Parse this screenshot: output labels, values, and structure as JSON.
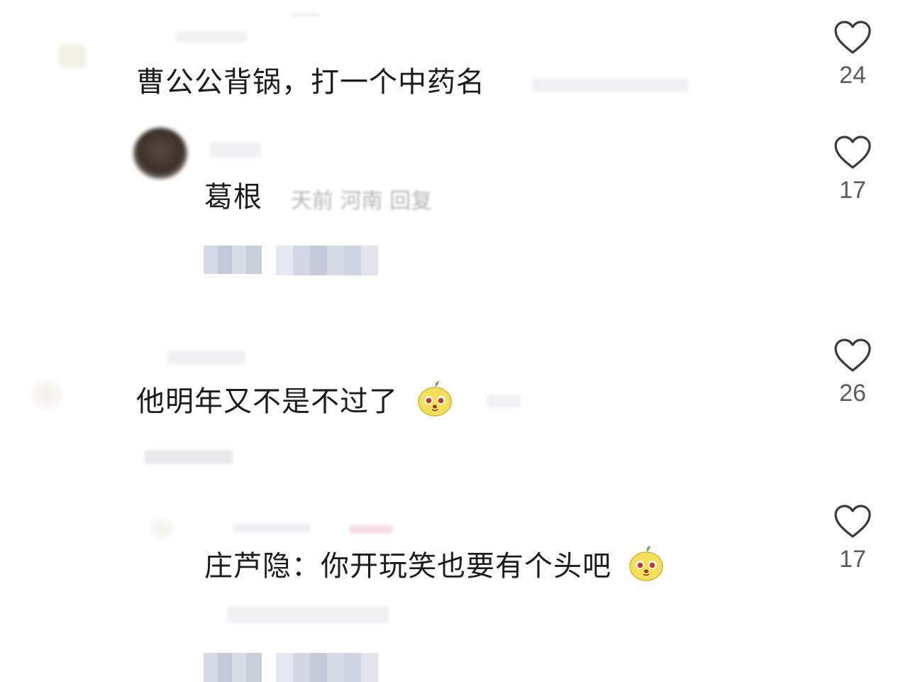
{
  "comments": [
    {
      "text": "曹公公背锅，打一个中药名",
      "likes": "24"
    },
    {
      "text": "葛根",
      "meta": "天前 河南 回复",
      "likes": "17"
    },
    {
      "text": "他明年又不是不过了",
      "likes": "26"
    },
    {
      "text": "庄芦隐：你开玩笑也要有个头吧",
      "likes": "17"
    }
  ],
  "icons": {
    "like": "heart-outline-icon",
    "emoji": "yellow-face-emoji-icon"
  },
  "colors": {
    "text": "#1c1c1c",
    "like_count": "#5c5c5c",
    "heart_stroke": "#3a3a3a",
    "emoji_yellow": "#f5de5a"
  }
}
